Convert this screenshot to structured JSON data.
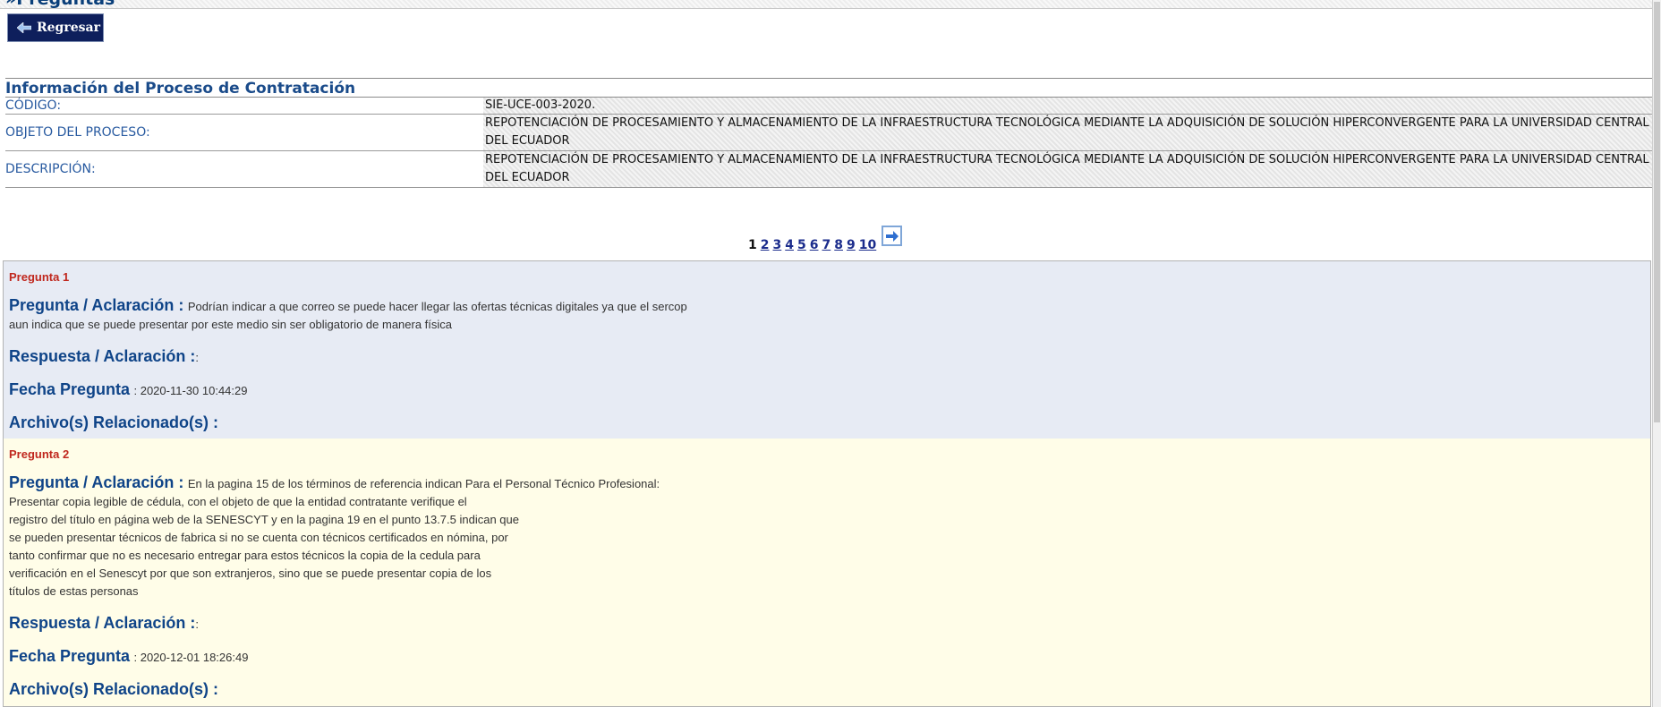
{
  "page": {
    "title": "»Preguntas"
  },
  "back_button": {
    "label": "Regresar",
    "icon": "arrow-left-icon"
  },
  "info": {
    "heading": "Información del Proceso de Contratación",
    "rows": [
      {
        "label": "CÓDIGO:",
        "value": "SIE-UCE-003-2020."
      },
      {
        "label": "OBJETO DEL PROCESO:",
        "value": "REPOTENCIACIÓN DE PROCESAMIENTO Y ALMACENAMIENTO DE LA INFRAESTRUCTURA TECNOLÓGICA MEDIANTE LA ADQUISICIÓN DE SOLUCIÓN HIPERCONVERGENTE PARA LA UNIVERSIDAD CENTRAL DEL ECUADOR"
      },
      {
        "label": "DESCRIPCIÓN:",
        "value": "REPOTENCIACIÓN DE PROCESAMIENTO Y ALMACENAMIENTO DE LA INFRAESTRUCTURA TECNOLÓGICA MEDIANTE LA ADQUISICIÓN DE SOLUCIÓN HIPERCONVERGENTE PARA LA UNIVERSIDAD CENTRAL DEL ECUADOR"
      }
    ]
  },
  "pager": {
    "current": "1",
    "pages": [
      "2",
      "3",
      "4",
      "5",
      "6",
      "7",
      "8",
      "9",
      "10"
    ],
    "next_icon": "arrow-right-icon"
  },
  "labels": {
    "pregunta": "Pregunta / Aclaración :",
    "respuesta": "Respuesta / Aclaración :",
    "fecha": "Fecha Pregunta",
    "archivos": "Archivo(s) Relacionado(s) :"
  },
  "questions": [
    {
      "title": "Pregunta 1",
      "text_first": "Podrían indicar a que correo se puede hacer llegar las ofertas técnicas digitales ya que el sercop",
      "text_rest": "aun indica que se puede presentar por este medio sin ser obligatorio de manera física",
      "respuesta": ":",
      "fecha": ": 2020-11-30 10:44:29"
    },
    {
      "title": "Pregunta 2",
      "text_first": "En la pagina 15 de los términos de referencia indican Para el Personal Técnico Profesional:",
      "text_rest": "Presentar copia legible de cédula, con el objeto de que la entidad contratante verifique el\nregistro del título en página web de la SENESCYT y en la pagina 19 en el punto 13.7.5 indican que\nse pueden presentar técnicos de fabrica si no se cuenta con técnicos certificados en nómina, por\ntanto confirmar que no es necesario entregar para estos técnicos la copia de la cedula para\nverificación en el Senescyt por que son extranjeros, sino que se puede presentar copia de los\ntítulos de estas personas",
      "respuesta": ":",
      "fecha": ": 2020-12-01 18:26:49"
    }
  ]
}
